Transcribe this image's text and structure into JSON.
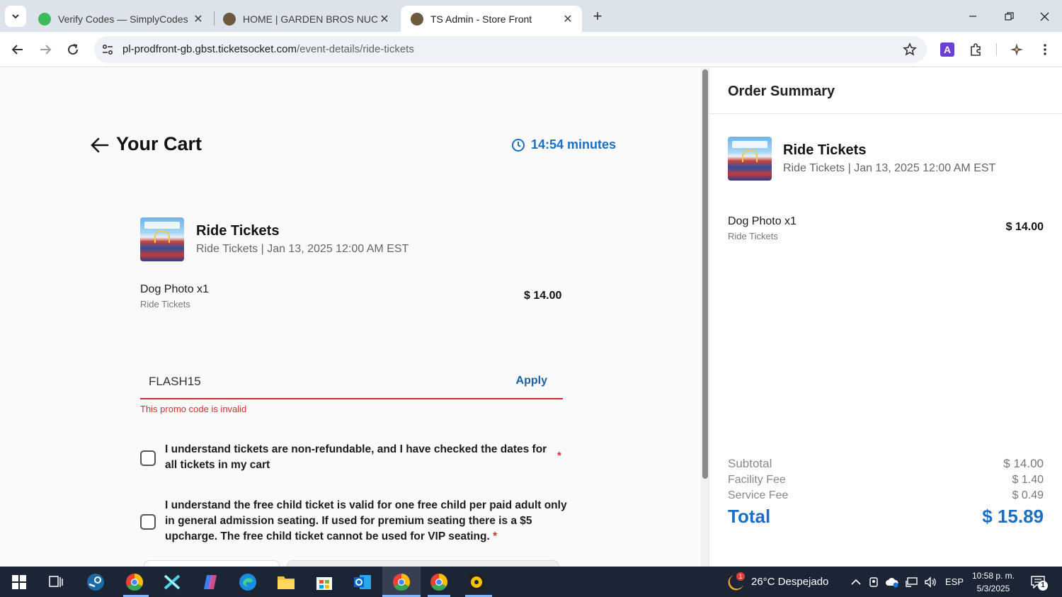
{
  "browser": {
    "tabs": [
      {
        "title": "Verify Codes — SimplyCodes",
        "active": false,
        "favicon_color": "#3dbb5a"
      },
      {
        "title": "HOME | GARDEN BROS NUCLEAR CIRCUS",
        "active": false,
        "favicon_color": "#6b5a3c"
      },
      {
        "title": "TS Admin - Store Front",
        "active": true,
        "favicon_color": "#6b5a3c"
      }
    ],
    "address": {
      "host": "pl-prodfront-gb.gbst.ticketsocket.com",
      "path": "/event-details/ride-tickets"
    },
    "extension_letter": "A"
  },
  "cart": {
    "title": "Your Cart",
    "timer": "14:54 minutes",
    "event": {
      "name": "Ride Tickets",
      "subtitle": "Ride Tickets | Jan 13, 2025 12:00 AM EST"
    },
    "item": {
      "name": "Dog Photo x1",
      "category": "Ride Tickets",
      "price": "$ 14.00"
    },
    "promo": {
      "value": "FLASH15",
      "apply_label": "Apply",
      "error": "This promo code is invalid"
    },
    "agreements": [
      {
        "text": "I understand tickets are non-refundable, and I have checked the dates for all tickets in my cart",
        "required_mark": "*",
        "checked": false
      },
      {
        "text": "I understand the free child ticket is valid for one free child per paid adult only in general admission seating. If used for premium seating there is a $5 upcharge. The free child ticket cannot be used for VIP seating.",
        "required_mark": "*",
        "checked": false
      }
    ]
  },
  "order_summary": {
    "title": "Order Summary",
    "event": {
      "name": "Ride Tickets",
      "subtitle": "Ride Tickets | Jan 13, 2025 12:00 AM EST"
    },
    "item": {
      "name": "Dog Photo x1",
      "category": "Ride Tickets",
      "price": "$ 14.00"
    },
    "subtotal_label": "Subtotal",
    "subtotal": "$ 14.00",
    "facility_fee_label": "Facility Fee",
    "facility_fee": "$ 1.40",
    "service_fee_label": "Service Fee",
    "service_fee": "$ 0.49",
    "total_label": "Total",
    "total": "$ 15.89"
  },
  "taskbar": {
    "weather": "26°C Despejado",
    "weather_badge": "1",
    "language": "ESP",
    "time": "10:58 p. m.",
    "date": "5/3/2025",
    "notification_count": "1"
  },
  "colors": {
    "accent": "#1a6fc4",
    "error": "#d32f2f",
    "taskbar": "#1c2535"
  }
}
